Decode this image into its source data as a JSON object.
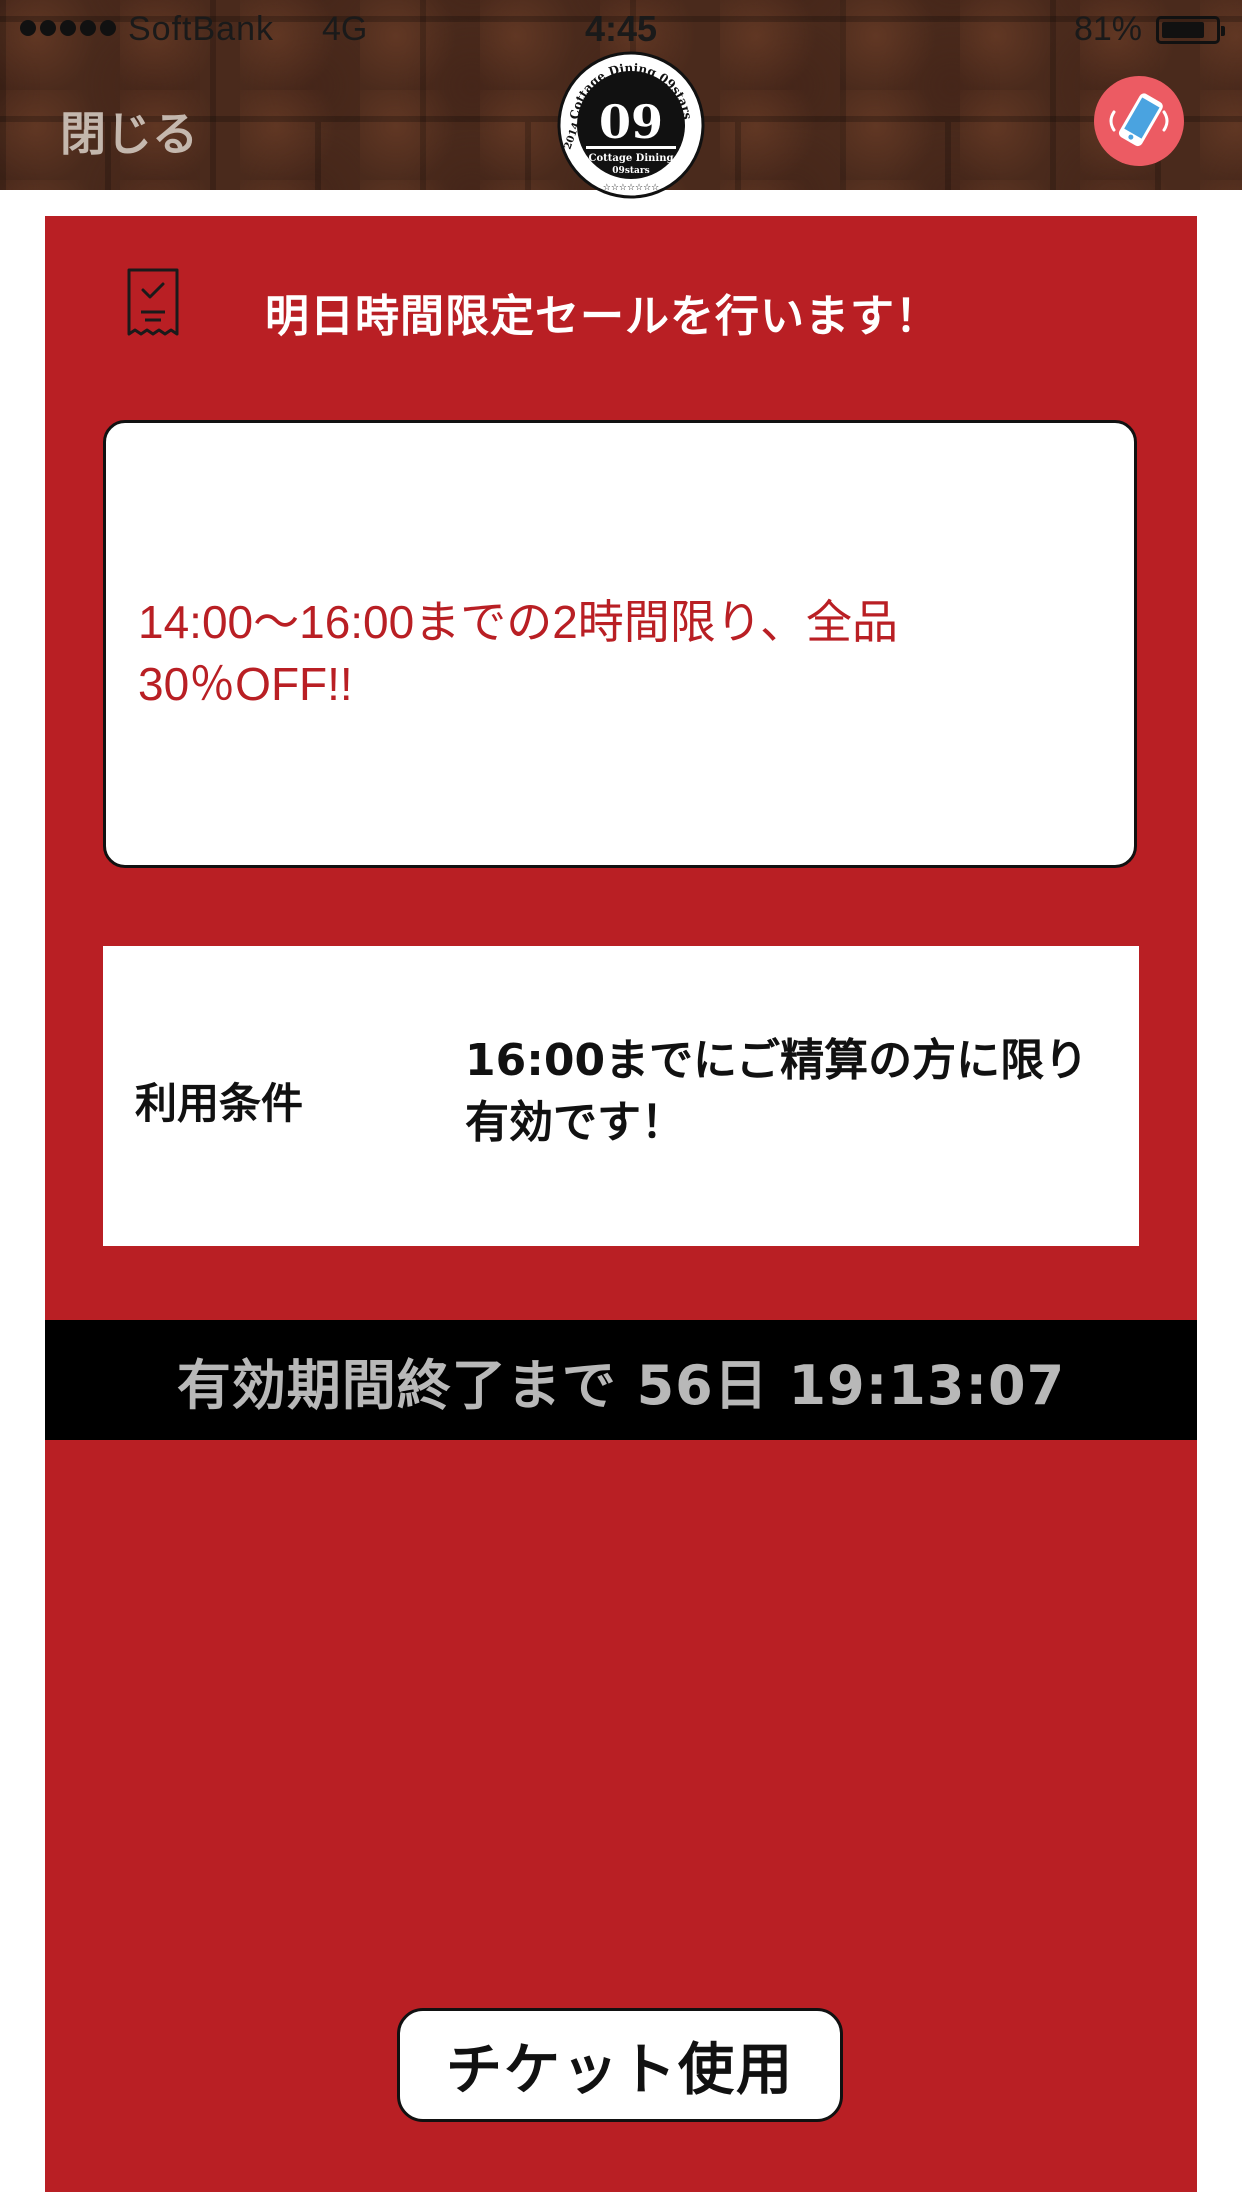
{
  "status_bar": {
    "carrier": "SoftBank",
    "network": "4G",
    "time": "4:45",
    "battery_percent": "81%",
    "battery_level": 0.81
  },
  "nav": {
    "close_label": "閉じる",
    "logo_number": "09",
    "logo_arc_text": "Cottage Dining 09stars",
    "logo_sub_text": "Cottage Dining",
    "logo_sub_text2": "09stars",
    "logo_year": "2014",
    "phone_icon": "phone-vibrate-icon"
  },
  "ticket": {
    "icon": "receipt-check-icon",
    "title": "明日時間限定セールを行います！",
    "description": "14:00〜16:00までの2時間限り、全品30％OFF!!",
    "conditions_label": "利用条件",
    "conditions_value": "16:00までにご精算の方に限り有効です！",
    "expiry_text": "有効期間終了まで 56日 19:13:07",
    "use_button_label": "チケット使用"
  },
  "colors": {
    "ticket_red": "#b91f24",
    "phone_button": "#ec5b63",
    "expiry_bar": "#000000",
    "expiry_text": "#b8b8b8"
  }
}
